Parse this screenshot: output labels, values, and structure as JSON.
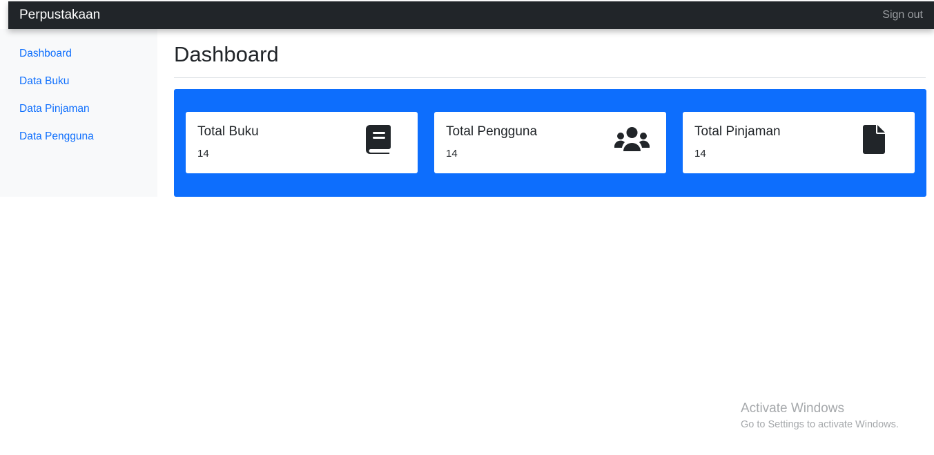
{
  "navbar": {
    "brand": "Perpustakaan",
    "signout_label": "Sign out"
  },
  "sidebar": {
    "items": [
      {
        "label": "Dashboard"
      },
      {
        "label": "Data Buku"
      },
      {
        "label": "Data Pinjaman"
      },
      {
        "label": "Data Pengguna"
      }
    ]
  },
  "main": {
    "title": "Dashboard",
    "cards": [
      {
        "title": "Total Buku",
        "value": "14",
        "icon": "book-icon"
      },
      {
        "title": "Total Pengguna",
        "value": "14",
        "icon": "users-icon"
      },
      {
        "title": "Total Pinjaman",
        "value": "14",
        "icon": "file-icon"
      }
    ]
  },
  "watermark": {
    "title": "Activate Windows",
    "subtitle": "Go to Settings to activate Windows."
  },
  "colors": {
    "navbar": "#212529",
    "sidebar": "#f8f9fa",
    "panel": "#0d6efd",
    "link": "#0d6efd"
  }
}
